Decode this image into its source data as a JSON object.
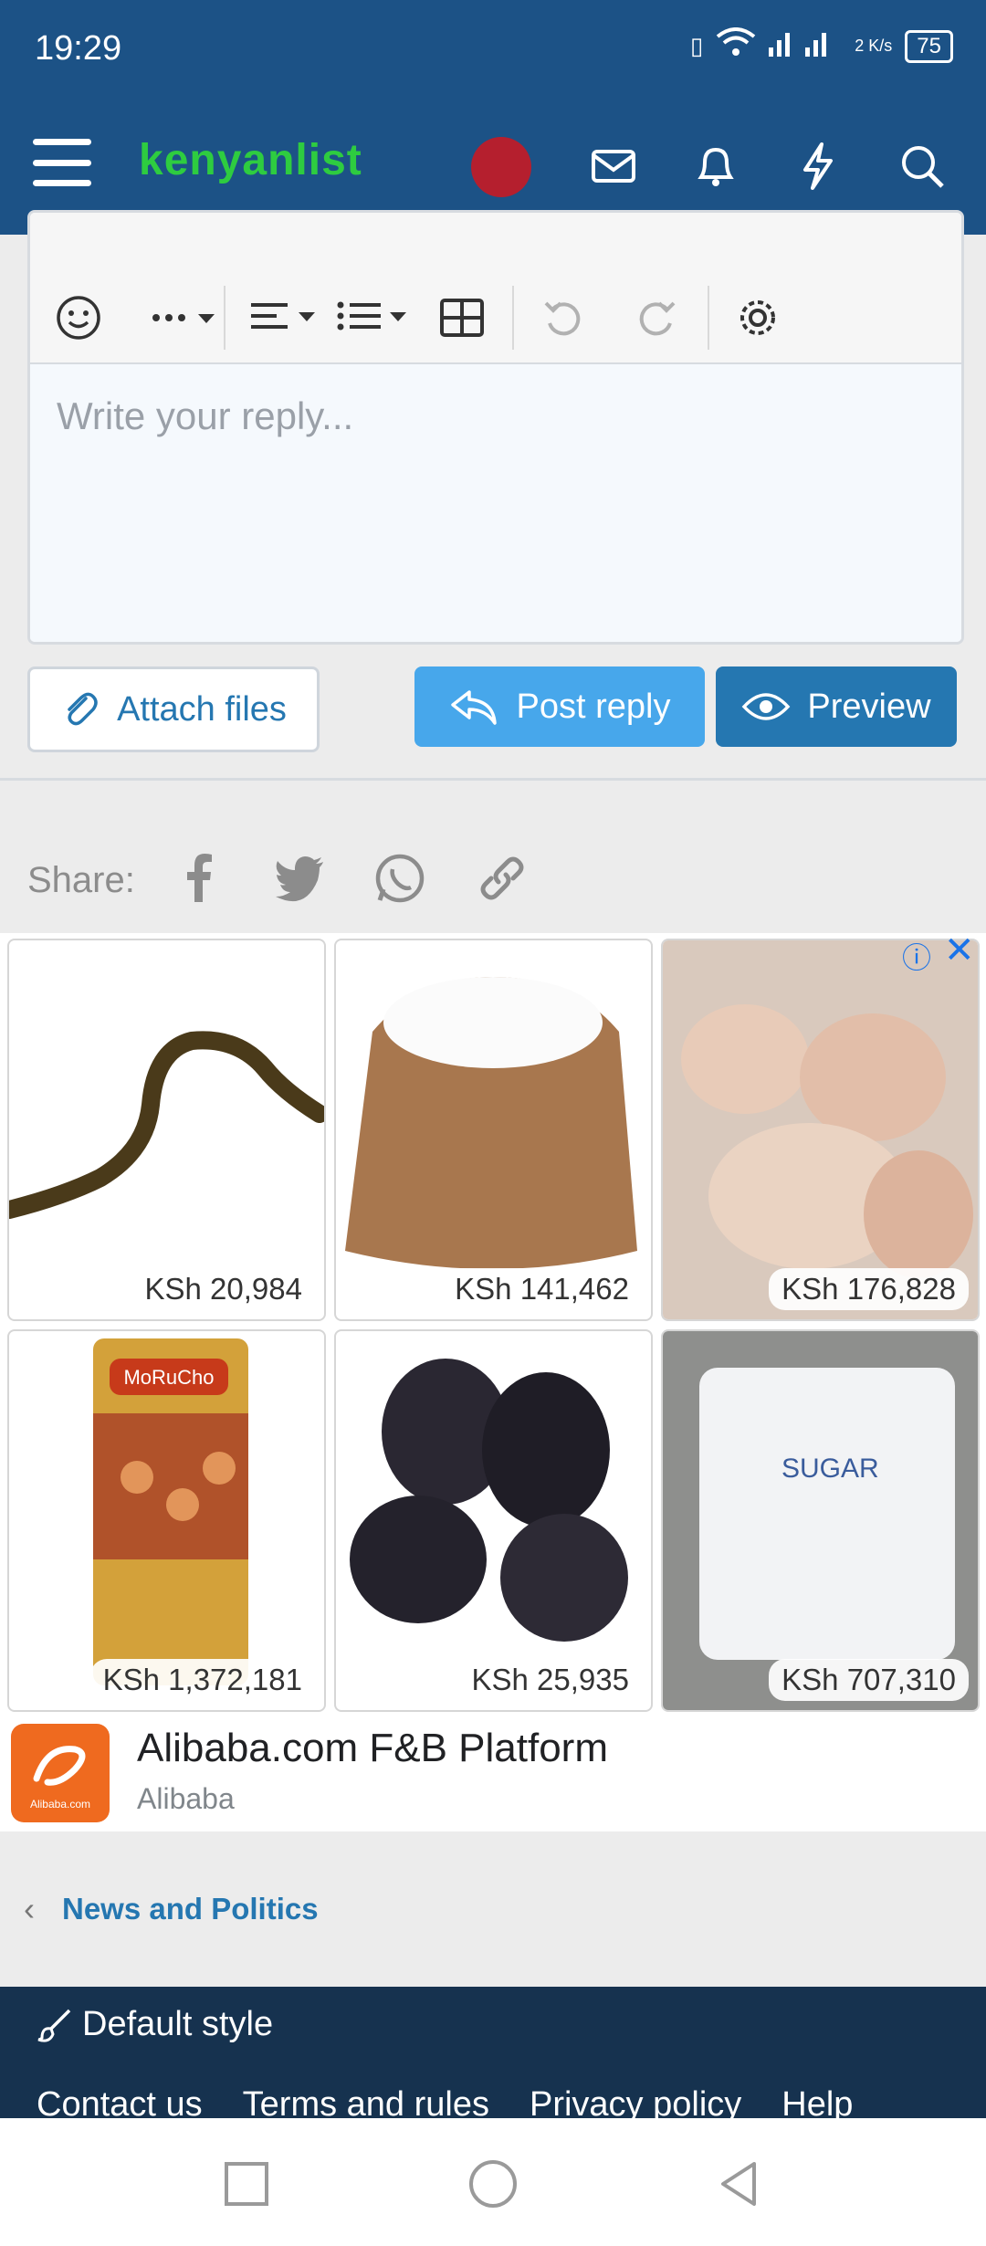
{
  "status_bar": {
    "time": "19:29",
    "network_speed": "2 K/s",
    "battery": "75"
  },
  "header": {
    "logo_text": "kenyanlist"
  },
  "editor": {
    "placeholder": "Write your reply..."
  },
  "actions": {
    "attach": "Attach files",
    "post": "Post reply",
    "preview": "Preview"
  },
  "share": {
    "label": "Share:",
    "icons": [
      "facebook-icon",
      "twitter-icon",
      "whatsapp-icon",
      "link-icon"
    ]
  },
  "ad": {
    "products": [
      {
        "name": "eel",
        "price": "KSh 20,984"
      },
      {
        "name": "sugar sack",
        "price": "KSh 141,462"
      },
      {
        "name": "frog legs",
        "price": "KSh 176,828"
      },
      {
        "name": "snack can",
        "price": "KSh 1,372,181"
      },
      {
        "name": "dates",
        "price": "KSh 25,935"
      },
      {
        "name": "sugar bag",
        "price": "KSh 707,310"
      }
    ],
    "advertiser_logo_text": "Alibaba.com",
    "advertiser_title": "Alibaba.com F&B Platform",
    "advertiser_sub": "Alibaba",
    "tile_label_sugar": "SUGAR",
    "brand_label": "MoRuCho"
  },
  "breadcrumb": {
    "label": "News and Politics"
  },
  "footer": {
    "style_label": "Default style",
    "links": [
      "Contact us",
      "Terms and rules",
      "Privacy policy",
      "Help"
    ]
  },
  "colors": {
    "header": "#1c5286",
    "accent": "#2577b1",
    "post": "#47a7eb",
    "footer": "#16324f",
    "logo": "#2ecc40"
  }
}
